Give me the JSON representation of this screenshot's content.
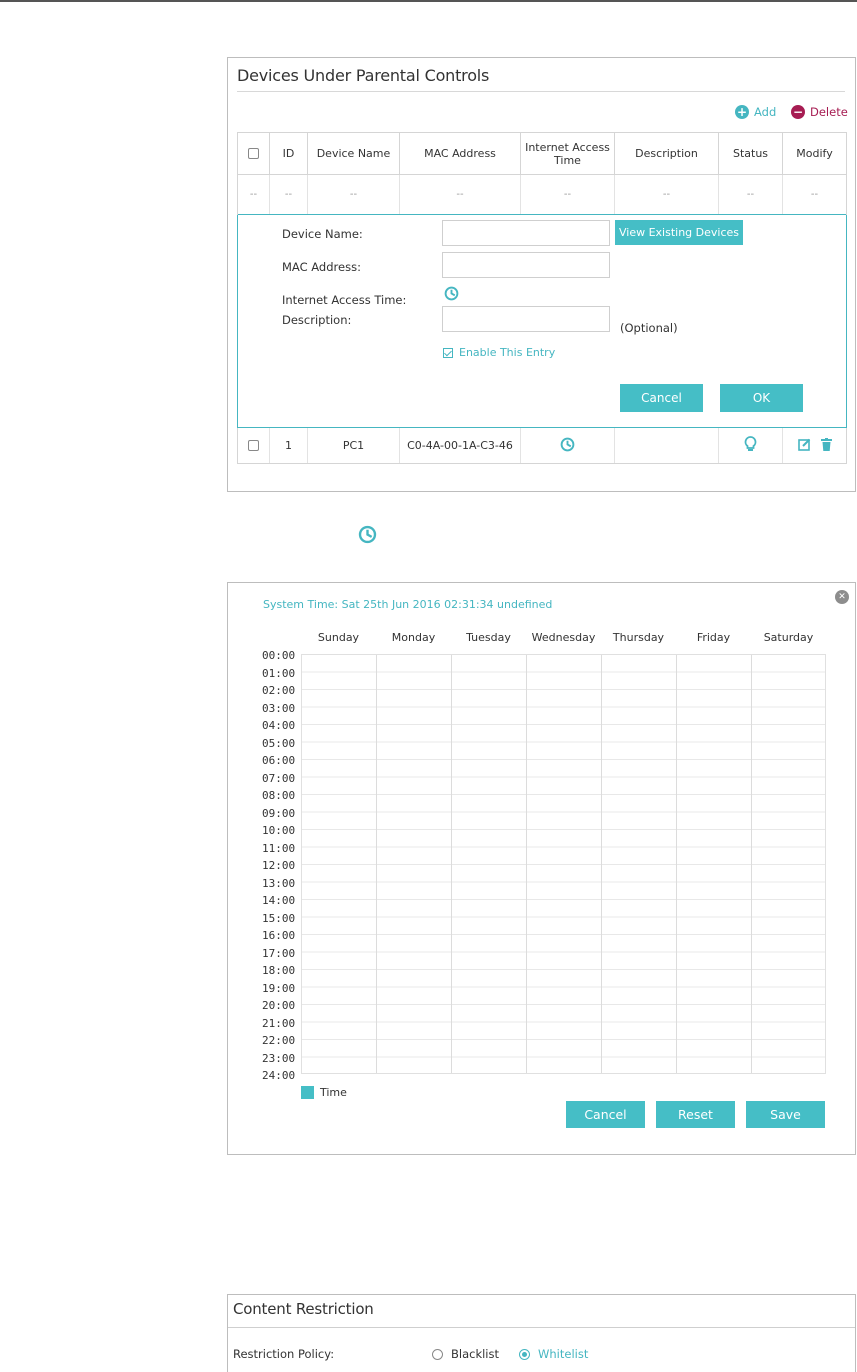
{
  "colors": {
    "accent": "#45b6c1",
    "delete": "#a61c52",
    "button": "#45bec6"
  },
  "devices_panel": {
    "title": "Devices Under Parental Controls",
    "add_label": "Add",
    "delete_label": "Delete",
    "columns": [
      "ID",
      "Device Name",
      "MAC Address",
      "Internet Access Time",
      "Description",
      "Status",
      "Modify"
    ],
    "empty_row": [
      "--",
      "--",
      "--",
      "--",
      "--",
      "--",
      "--",
      "--"
    ],
    "form": {
      "device_name_label": "Device Name:",
      "mac_address_label": "MAC Address:",
      "access_time_label": "Internet Access Time:",
      "description_label": "Description:",
      "optional_label": "(Optional)",
      "view_existing_label": "View Existing Devices",
      "enable_label": "Enable This Entry",
      "enable_checked": true,
      "cancel_label": "Cancel",
      "ok_label": "OK"
    },
    "device_row": {
      "id": "1",
      "device_name": "PC1",
      "mac_address": "C0-4A-00-1A-C3-46",
      "description": ""
    }
  },
  "schedule_panel": {
    "system_time": "System Time: Sat 25th Jun 2016 02:31:34 undefined",
    "days": [
      "Sunday",
      "Monday",
      "Tuesday",
      "Wednesday",
      "Thursday",
      "Friday",
      "Saturday"
    ],
    "hours": [
      "00:00",
      "01:00",
      "02:00",
      "03:00",
      "04:00",
      "05:00",
      "06:00",
      "07:00",
      "08:00",
      "09:00",
      "10:00",
      "11:00",
      "12:00",
      "13:00",
      "14:00",
      "15:00",
      "16:00",
      "17:00",
      "18:00",
      "19:00",
      "20:00",
      "21:00",
      "22:00",
      "23:00",
      "24:00"
    ],
    "legend_label": "Time",
    "cancel_label": "Cancel",
    "reset_label": "Reset",
    "save_label": "Save"
  },
  "content_panel": {
    "title": "Content Restriction",
    "policy_label": "Restriction Policy:",
    "blacklist_label": "Blacklist",
    "whitelist_label": "Whitelist",
    "selected": "Whitelist"
  }
}
